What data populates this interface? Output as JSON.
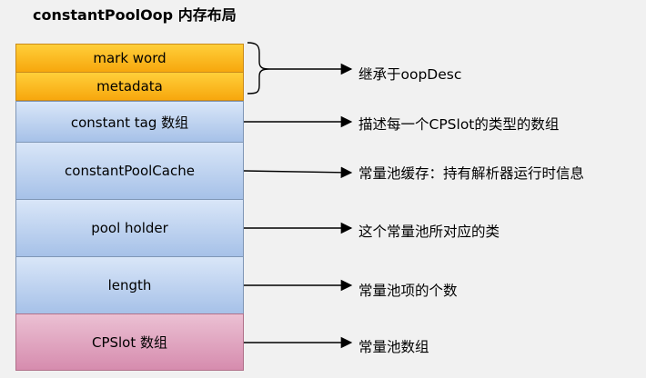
{
  "title": "constantPoolOop 内存布局",
  "blocks": [
    {
      "text": "mark word"
    },
    {
      "text": "metadata"
    },
    {
      "text": "constant tag 数组"
    },
    {
      "text": "constantPoolCache"
    },
    {
      "text": "pool holder"
    },
    {
      "text": "length"
    },
    {
      "text": "CPSlot 数组"
    }
  ],
  "annotations": [
    "继承于oopDesc",
    "描述每一个CPSlot的类型的数组",
    "常量池缓存：持有解析器运行时信息",
    "这个常量池所对应的类",
    "常量池项的个数",
    "常量池数组"
  ]
}
